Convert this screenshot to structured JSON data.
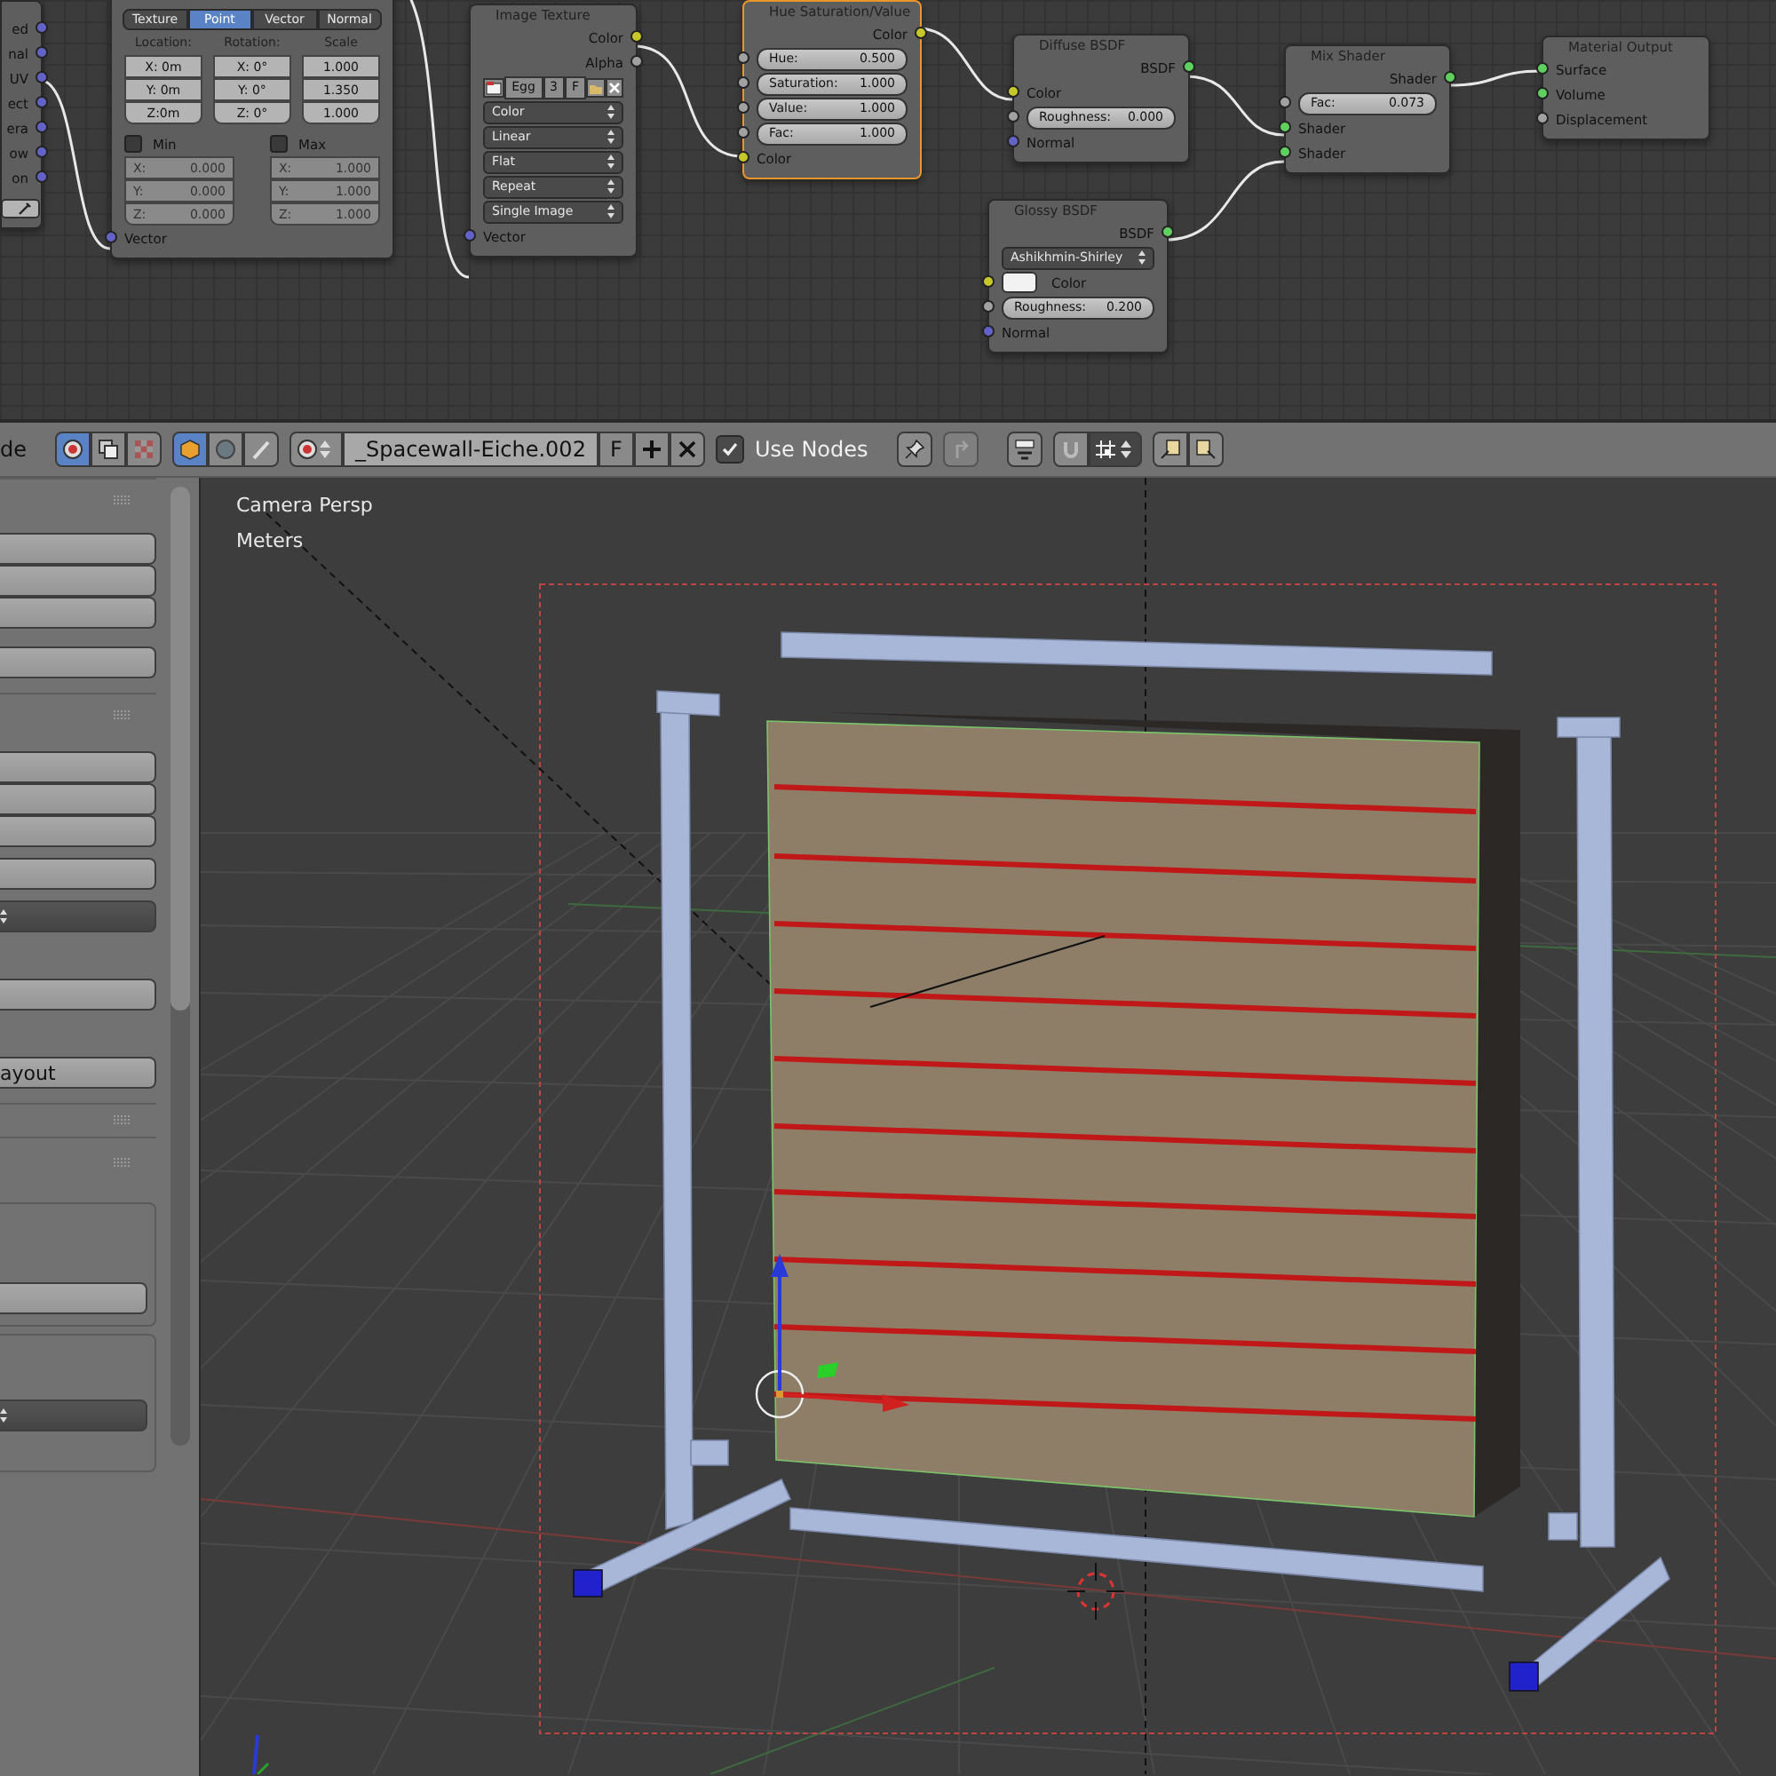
{
  "node_editor": {
    "nodes": [
      {
        "kind": "partial",
        "selected": false,
        "rows": [
          {
            "kind": "output",
            "label": "ed",
            "color": "#6363c7"
          },
          {
            "kind": "output",
            "label": "nal",
            "color": "#6363c7"
          },
          {
            "kind": "output",
            "label": "UV",
            "color": "#6363c7"
          },
          {
            "kind": "output",
            "label": "ect",
            "color": "#6363c7"
          },
          {
            "kind": "output",
            "label": "era",
            "color": "#6363c7"
          },
          {
            "kind": "output",
            "label": "ow",
            "color": "#6363c7"
          },
          {
            "kind": "output",
            "label": "on",
            "color": "#6363c7"
          },
          {
            "kind": "eyedropper"
          }
        ]
      },
      {
        "kind": "mapping",
        "selected": false,
        "rows": [
          {
            "kind": "tabs",
            "tabs": [
              {
                "label": "Texture",
                "selected": false
              },
              {
                "label": "Point",
                "selected": true
              },
              {
                "label": "Vector",
                "selected": false
              },
              {
                "label": "Normal",
                "selected": false
              }
            ]
          },
          {
            "kind": "vector_columns",
            "columns": [
              {
                "heading": "Location:",
                "fields": [
                  "X: 0m",
                  "Y: 0m",
                  "Z:0m"
                ]
              },
              {
                "heading": "Rotation:",
                "fields": [
                  "X:   0°",
                  "Y:   0°",
                  "Z:  0°"
                ]
              },
              {
                "heading": "Scale",
                "fields": [
                  "1.000",
                  "1.350",
                  "1.000"
                ]
              }
            ]
          },
          {
            "kind": "min_max",
            "groups": [
              {
                "label": "Min",
                "checked": false,
                "fields": [
                  {
                    "axis": "X:",
                    "value": "0.000"
                  },
                  {
                    "axis": "Y:",
                    "value": "0.000"
                  },
                  {
                    "axis": "Z:",
                    "value": "0.000"
                  }
                ]
              },
              {
                "label": "Max",
                "checked": false,
                "fields": [
                  {
                    "axis": "X:",
                    "value": "1.000"
                  },
                  {
                    "axis": "Y:",
                    "value": "1.000"
                  },
                  {
                    "axis": "Z:",
                    "value": "1.000"
                  }
                ]
              }
            ]
          },
          {
            "kind": "input",
            "label": "Vector",
            "color": "#6363c7"
          }
        ]
      },
      {
        "kind": "node",
        "title": "Image Texture",
        "selected": false,
        "rows": [
          {
            "kind": "output",
            "label": "Color",
            "color": "#c7c729"
          },
          {
            "kind": "output",
            "label": "Alpha",
            "color": "#a1a1a1"
          },
          {
            "kind": "image_selector",
            "name": "Egg",
            "users": "3",
            "fake_user": "F"
          },
          {
            "kind": "dropdown",
            "value": "Color"
          },
          {
            "kind": "dropdown",
            "value": "Linear"
          },
          {
            "kind": "dropdown",
            "value": "Flat"
          },
          {
            "kind": "dropdown",
            "value": "Repeat"
          },
          {
            "kind": "dropdown",
            "value": "Single Image"
          },
          {
            "kind": "input",
            "label": "Vector",
            "color": "#6363c7"
          }
        ]
      },
      {
        "kind": "node",
        "title": "Hue Saturation/Value",
        "selected": true,
        "rows": [
          {
            "kind": "output",
            "label": "Color",
            "color": "#c7c729"
          },
          {
            "kind": "slider",
            "label": "Hue:",
            "value": "0.500",
            "color": "#a1a1a1"
          },
          {
            "kind": "slider",
            "label": "Saturation:",
            "value": "1.000",
            "color": "#a1a1a1"
          },
          {
            "kind": "slider",
            "label": "Value:",
            "value": "1.000",
            "color": "#a1a1a1"
          },
          {
            "kind": "slider",
            "label": "Fac:",
            "value": "1.000",
            "color": "#a1a1a1"
          },
          {
            "kind": "input",
            "label": "Color",
            "color": "#c7c729"
          }
        ]
      },
      {
        "kind": "node",
        "title": "Diffuse BSDF",
        "selected": false,
        "rows": [
          {
            "kind": "output",
            "label": "BSDF",
            "color": "#5fcf5f"
          },
          {
            "kind": "input",
            "label": "Color",
            "color": "#c7c729"
          },
          {
            "kind": "slider",
            "label": "Roughness:",
            "value": "0.000",
            "color": "#a1a1a1"
          },
          {
            "kind": "input",
            "label": "Normal",
            "color": "#6363c7"
          }
        ]
      },
      {
        "kind": "node",
        "title": "Glossy BSDF",
        "selected": false,
        "rows": [
          {
            "kind": "output",
            "label": "BSDF",
            "color": "#5fcf5f"
          },
          {
            "kind": "dropdown",
            "value": "Ashikhmin-Shirley"
          },
          {
            "kind": "swatch",
            "label": "Color",
            "color": "#c7c729"
          },
          {
            "kind": "slider",
            "label": "Roughness:",
            "value": "0.200",
            "color": "#a1a1a1"
          },
          {
            "kind": "input",
            "label": "Normal",
            "color": "#6363c7"
          }
        ]
      },
      {
        "kind": "node",
        "title": "Mix Shader",
        "selected": false,
        "rows": [
          {
            "kind": "output",
            "label": "Shader",
            "color": "#5fcf5f"
          },
          {
            "kind": "slider",
            "label": "Fac:",
            "value": "0.073",
            "color": "#a1a1a1"
          },
          {
            "kind": "input",
            "label": "Shader",
            "color": "#5fcf5f"
          },
          {
            "kind": "input",
            "label": "Shader",
            "color": "#5fcf5f"
          }
        ]
      },
      {
        "kind": "node",
        "title": "Material Output",
        "selected": false,
        "rows": [
          {
            "kind": "input",
            "label": "Surface",
            "color": "#5fcf5f"
          },
          {
            "kind": "input",
            "label": "Volume",
            "color": "#5fcf5f"
          },
          {
            "kind": "input",
            "label": "Displacement",
            "color": "#a1a1a1"
          }
        ]
      }
    ]
  },
  "header": {
    "mode_label": "de",
    "context_buttons": [
      {
        "selected": true
      },
      {
        "selected": false
      },
      {
        "selected": false
      }
    ],
    "type_buttons": [
      {
        "selected": true
      },
      {
        "selected": false
      },
      {
        "selected": false
      }
    ],
    "material_name": "_Spacewall-Eiche.002",
    "fake_user_label": "F",
    "use_nodes": {
      "label": "Use Nodes",
      "checked": true
    },
    "parent_button": {
      "disabled": true
    }
  },
  "properties_panel": {
    "button_label": "ayout"
  },
  "viewport": {
    "view_label": "Camera Persp",
    "units_label": "Meters"
  }
}
